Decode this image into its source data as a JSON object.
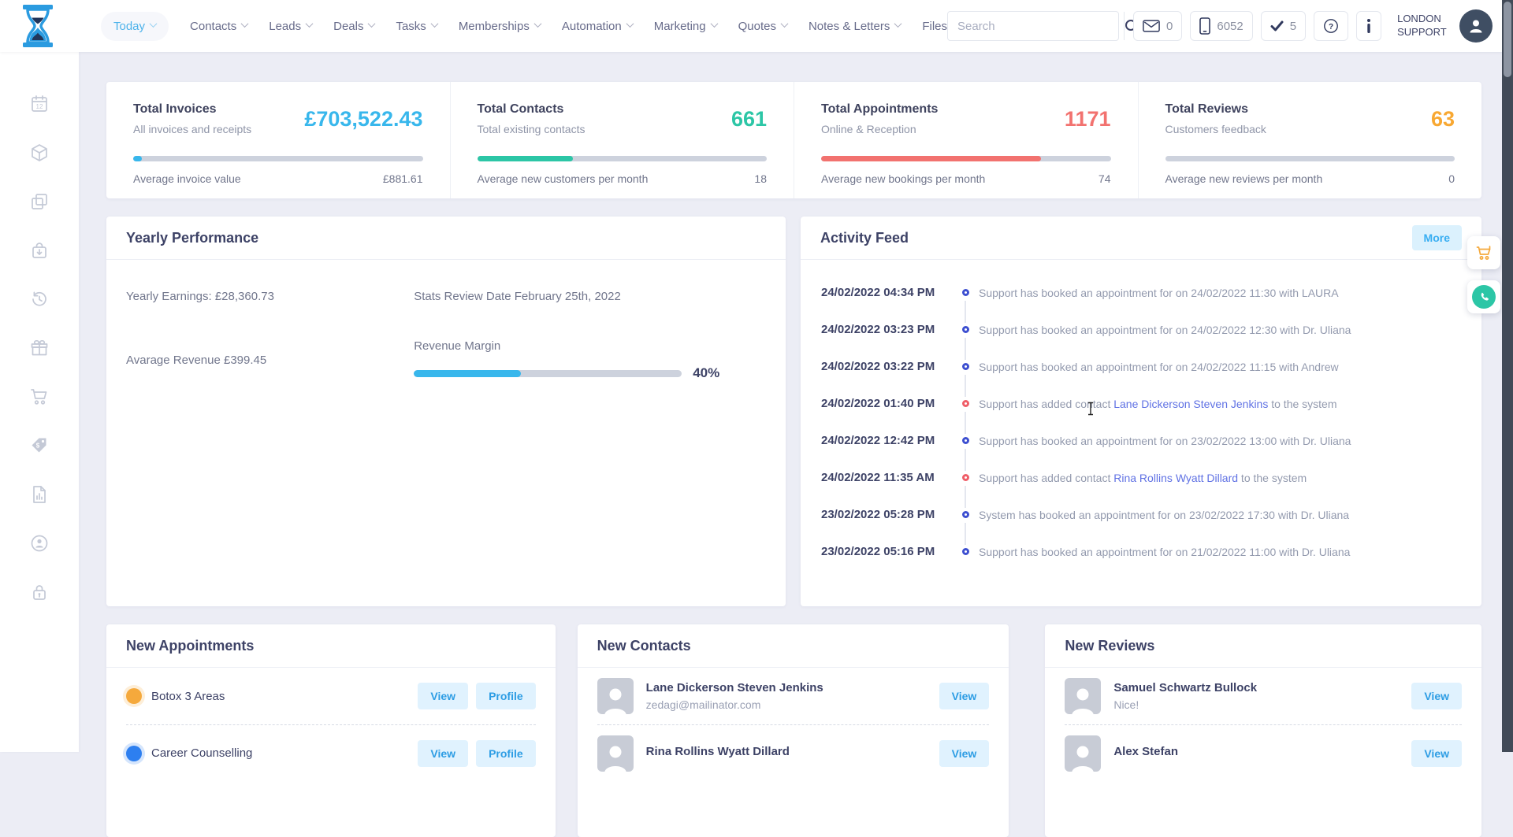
{
  "nav": {
    "items": [
      "Today",
      "Contacts",
      "Leads",
      "Deals",
      "Tasks",
      "Memberships",
      "Automation",
      "Marketing",
      "Quotes",
      "Notes & Letters",
      "Files"
    ],
    "search_placeholder": "Search",
    "badges": {
      "mail": "0",
      "phone": "6052",
      "tasks": "5"
    },
    "user": {
      "line1": "LONDON",
      "line2": "SUPPORT"
    }
  },
  "sidebar": {
    "icons": [
      "calendar-icon",
      "package-icon",
      "duplicate-icon",
      "bag-download-icon",
      "history-icon",
      "gift-icon",
      "cart-icon",
      "price-tag-icon",
      "report-icon",
      "account-icon",
      "lock-icon"
    ]
  },
  "stats": [
    {
      "title": "Total Invoices",
      "subtitle": "All invoices and receipts",
      "value": "£703,522.43",
      "color": "#38b7ec",
      "progress_pct": 3,
      "footer_label": "Average invoice value",
      "footer_value": "£881.61"
    },
    {
      "title": "Total Contacts",
      "subtitle": "Total existing contacts",
      "value": "661",
      "color": "#2cc6a6",
      "progress_pct": 33,
      "footer_label": "Average new customers per month",
      "footer_value": "18"
    },
    {
      "title": "Total Appointments",
      "subtitle": "Online & Reception",
      "value": "1171",
      "color": "#f2726f",
      "progress_pct": 76,
      "footer_label": "Average new bookings per month",
      "footer_value": "74"
    },
    {
      "title": "Total Reviews",
      "subtitle": "Customers feedback",
      "value": "63",
      "color": "#f8a832",
      "progress_pct": 0,
      "footer_label": "Average new reviews per month",
      "footer_value": "0"
    }
  ],
  "yearly": {
    "title": "Yearly Performance",
    "yearly_earnings": "Yearly Earnings: £28,360.73",
    "stats_review": "Stats Review Date February 25th, 2022",
    "average_revenue": "Avarage Revenue £399.45",
    "margin_label": "Revenue Margin",
    "margin_pct": "40%",
    "margin_value": 40,
    "margin_color": "#38b7ec"
  },
  "activity": {
    "title": "Activity Feed",
    "more_label": "More",
    "entries": [
      {
        "time": "24/02/2022 04:34 PM",
        "dot_color": "#3d4fd0",
        "pre": "Support has booked an appointment for on 24/02/2022 11:30 with LAURA",
        "link": "",
        "post": ""
      },
      {
        "time": "24/02/2022 03:23 PM",
        "dot_color": "#3d4fd0",
        "pre": "Support has booked an appointment for on 24/02/2022 12:30 with Dr. Uliana",
        "link": "",
        "post": ""
      },
      {
        "time": "24/02/2022 03:22 PM",
        "dot_color": "#3d4fd0",
        "pre": "Support has booked an appointment for on 24/02/2022 11:15 with Andrew",
        "link": "",
        "post": ""
      },
      {
        "time": "24/02/2022 01:40 PM",
        "dot_color": "#ef5e68",
        "pre": "Support has added contact ",
        "link": "Lane Dickerson Steven Jenkins",
        "post": " to the system"
      },
      {
        "time": "24/02/2022 12:42 PM",
        "dot_color": "#3d4fd0",
        "pre": "Support has booked an appointment for on 23/02/2022 13:00 with Dr. Uliana",
        "link": "",
        "post": ""
      },
      {
        "time": "24/02/2022 11:35 AM",
        "dot_color": "#ef5e68",
        "pre": "Support has added contact ",
        "link": "Rina Rollins Wyatt Dillard",
        "post": " to the system"
      },
      {
        "time": "23/02/2022 05:28 PM",
        "dot_color": "#3d4fd0",
        "pre": "System has booked an appointment for on 23/02/2022 17:30 with Dr. Uliana",
        "link": "",
        "post": ""
      },
      {
        "time": "23/02/2022 05:16 PM",
        "dot_color": "#3d4fd0",
        "pre": "Support has booked an appointment for on 21/02/2022 11:00 with Dr. Uliana",
        "link": "",
        "post": ""
      }
    ]
  },
  "panels": {
    "appointments": {
      "title": "New Appointments",
      "view_label": "View",
      "profile_label": "Profile",
      "rows": [
        {
          "label": "Botox 3 Areas",
          "dot_color": "#f5a93c"
        },
        {
          "label": "Career Counselling",
          "dot_color": "#2d7ff0"
        }
      ]
    },
    "contacts": {
      "title": "New Contacts",
      "view_label": "View",
      "rows": [
        {
          "name": "Lane Dickerson Steven Jenkins",
          "email": "zedagi@mailinator.com"
        },
        {
          "name": "Rina Rollins Wyatt Dillard",
          "email": ""
        }
      ]
    },
    "reviews": {
      "title": "New Reviews",
      "view_label": "View",
      "rows": [
        {
          "name": "Samuel Schwartz Bullock",
          "comment": "Nice!"
        },
        {
          "name": "Alex Stefan",
          "comment": ""
        }
      ]
    }
  }
}
